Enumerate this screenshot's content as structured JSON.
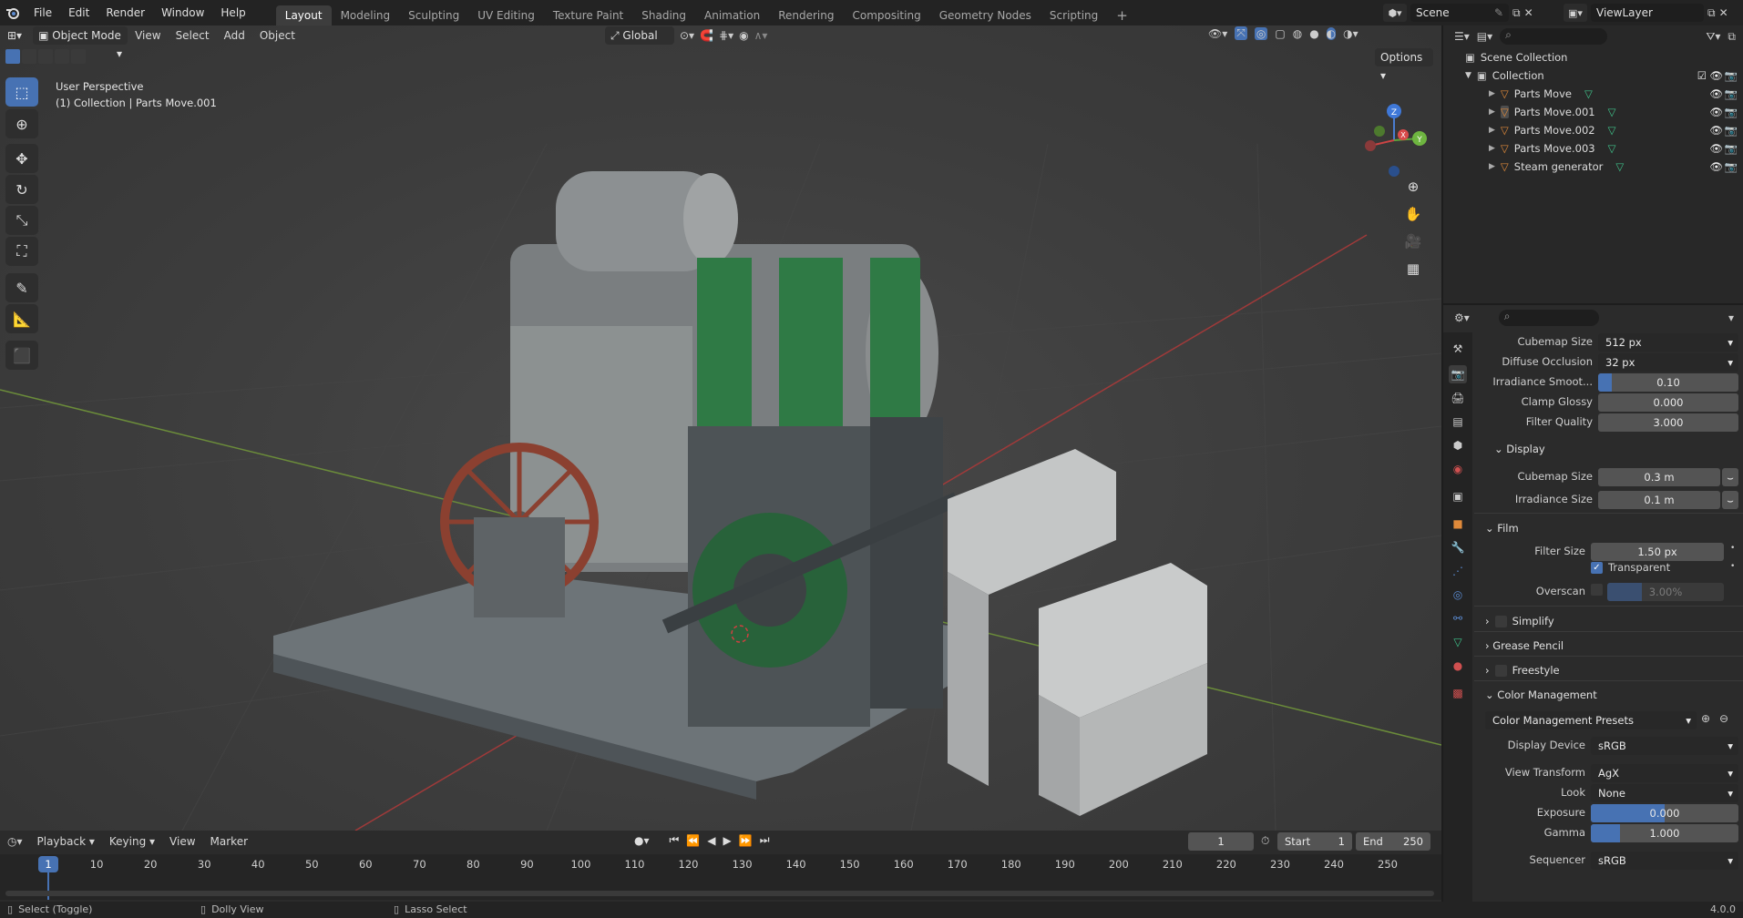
{
  "topbar": {
    "menus": [
      "File",
      "Edit",
      "Render",
      "Window",
      "Help"
    ],
    "workspaces": [
      "Layout",
      "Modeling",
      "Sculpting",
      "UV Editing",
      "Texture Paint",
      "Shading",
      "Animation",
      "Rendering",
      "Compositing",
      "Geometry Nodes",
      "Scripting"
    ],
    "active_workspace": "Layout",
    "scene": "Scene",
    "view_layer": "ViewLayer"
  },
  "viewport_header": {
    "mode": "Object Mode",
    "menus": [
      "View",
      "Select",
      "Add",
      "Object"
    ],
    "orientation": "Global",
    "options": "Options"
  },
  "viewport": {
    "perspective": "User Perspective",
    "context": "(1) Collection | Parts Move.001",
    "axis_x": "X",
    "axis_y": "Y",
    "axis_z": "Z"
  },
  "outliner": {
    "scene_collection": "Scene Collection",
    "collection": "Collection",
    "items": [
      "Parts Move",
      "Parts Move.001",
      "Parts Move.002",
      "Parts Move.003",
      "Steam generator"
    ]
  },
  "properties": {
    "rows": {
      "cubemap_size_label": "Cubemap Size",
      "cubemap_size": "512 px",
      "diffuse_occlusion_label": "Diffuse Occlusion",
      "diffuse_occlusion": "32 px",
      "irradiance_smooth_label": "Irradiance Smoot...",
      "irradiance_smooth": "0.10",
      "clamp_glossy_label": "Clamp Glossy",
      "clamp_glossy": "0.000",
      "filter_quality_label": "Filter Quality",
      "filter_quality": "3.000"
    },
    "display": {
      "title": "Display",
      "cubemap_size_label": "Cubemap Size",
      "cubemap_size": "0.3 m",
      "irradiance_size_label": "Irradiance Size",
      "irradiance_size": "0.1 m"
    },
    "film": {
      "title": "Film",
      "filter_size_label": "Filter Size",
      "filter_size": "1.50 px",
      "transparent_label": "Transparent",
      "overscan_label": "Overscan",
      "overscan": "3.00%"
    },
    "collapsed": [
      "Simplify",
      "Grease Pencil",
      "Freestyle"
    ],
    "color_management": {
      "title": "Color Management",
      "presets": "Color Management Presets",
      "display_device_label": "Display Device",
      "display_device": "sRGB",
      "view_transform_label": "View Transform",
      "view_transform": "AgX",
      "look_label": "Look",
      "look": "None",
      "exposure_label": "Exposure",
      "exposure": "0.000",
      "gamma_label": "Gamma",
      "gamma": "1.000",
      "sequencer_label": "Sequencer",
      "sequencer": "sRGB"
    }
  },
  "timeline": {
    "menus": [
      "Playback",
      "Keying",
      "View",
      "Marker"
    ],
    "current_frame": "1",
    "start_label": "Start",
    "start": "1",
    "end_label": "End",
    "end": "250",
    "frame_ticks": [
      "1",
      "10",
      "20",
      "30",
      "40",
      "50",
      "60",
      "70",
      "80",
      "90",
      "100",
      "110",
      "120",
      "130",
      "140",
      "150",
      "160",
      "170",
      "180",
      "190",
      "200",
      "210",
      "220",
      "230",
      "240",
      "250"
    ],
    "playhead": "1"
  },
  "statusbar": {
    "select": "Select (Toggle)",
    "dolly": "Dolly View",
    "lasso": "Lasso Select",
    "version": "4.0.0"
  }
}
